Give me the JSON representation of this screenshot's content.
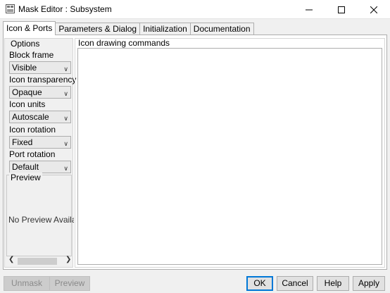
{
  "window": {
    "title": "Mask Editor : Subsystem",
    "icon": "simulink-block-icon",
    "controls": [
      "minimize-icon",
      "maximize-icon",
      "close-icon"
    ]
  },
  "tabs": [
    {
      "label": "Icon & Ports",
      "active": true
    },
    {
      "label": "Parameters & Dialog",
      "active": false
    },
    {
      "label": "Initialization",
      "active": false
    },
    {
      "label": "Documentation",
      "active": false
    }
  ],
  "options": {
    "heading": "Options",
    "block_frame": {
      "label": "Block frame",
      "value": "Visible"
    },
    "icon_transparency": {
      "label": "Icon transparency",
      "value": "Opaque"
    },
    "icon_units": {
      "label": "Icon units",
      "value": "Autoscale"
    },
    "icon_rotation": {
      "label": "Icon rotation",
      "value": "Fixed"
    },
    "port_rotation": {
      "label": "Port rotation",
      "value": "Default"
    }
  },
  "preview": {
    "title": "Preview",
    "text": "No Preview Available"
  },
  "commands": {
    "title": "Icon drawing commands",
    "value": ""
  },
  "buttons": {
    "unmask": "Unmask",
    "preview": "Preview",
    "ok": "OK",
    "cancel": "Cancel",
    "help": "Help",
    "apply": "Apply"
  }
}
